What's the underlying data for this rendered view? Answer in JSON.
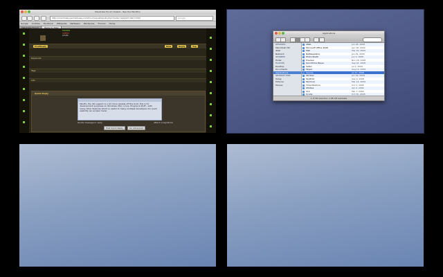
{
  "browser": {
    "title": "Mandrake Forum Hosted - Tear the Mindflux",
    "url": "http://mandrake.seomadness.com/forums/posts/post.php?mode=reply&f=1&t=1344",
    "search_placeholder": "Google",
    "bookmarks": [
      "Google",
      "YouTube",
      "Facebook",
      "Wikipedia",
      "Netbeans",
      "Wordpress",
      "Forums",
      "Home"
    ],
    "tabs": [
      "Mandrake Forum",
      "Reply to Topic"
    ],
    "forum": {
      "stats": [
        "POWER",
        "SPEED",
        "LEVEL"
      ],
      "post_reply_label": "PostReply",
      "right_buttons": [
        "New",
        "Reply",
        "Top"
      ],
      "sections": [
        "Keywords",
        "Tags",
        "Info"
      ],
      "quick_reply_title": "Quick Reply",
      "reply_text": "Mindfx, the XD support is a lot more reliable off the boot, this is for development purposes on Windows, Mac, Linux, Plugins & Stuff - with many other features which is useful to many multiple developers for quick usability (an answer here).",
      "checkboxes": [
        "Quote message in reply",
        "Attach a signature"
      ],
      "buttons": [
        "Post Quick Reply",
        "Go Advanced"
      ]
    }
  },
  "finder": {
    "title": "Applications",
    "sidebar": [
      {
        "label": "DEVICES",
        "header": true
      },
      {
        "label": "Macintosh HD"
      },
      {
        "label": "iDisk"
      },
      {
        "label": "Network"
      },
      {
        "label": "SHARED",
        "header": true
      },
      {
        "label": "finder"
      },
      {
        "label": "PLACES",
        "header": true
      },
      {
        "label": "Desktop"
      },
      {
        "label": "Documents"
      },
      {
        "label": "Applications",
        "selected": true
      },
      {
        "label": "SEARCH FOR",
        "header": true
      },
      {
        "label": "Today"
      },
      {
        "label": "Pictures"
      },
      {
        "label": "Movies"
      }
    ],
    "items": [
      {
        "name": "iWeb",
        "date": "Jun 18, 2008"
      },
      {
        "name": "Microsoft Office 2008",
        "date": "Apr 18, 2009"
      },
      {
        "name": "Mail",
        "date": "Mar 10, 2009"
      },
      {
        "name": "NetNewsWire",
        "date": "Jan 29, 2009"
      },
      {
        "name": "Photo Booth",
        "date": "Jun 5, 2008"
      },
      {
        "name": "Preview",
        "date": "Nov 26, 2008"
      },
      {
        "name": "QuickTime Player",
        "date": "Sep 24, 2008"
      },
      {
        "name": "Safari",
        "date": "Jul 2, 2009"
      },
      {
        "name": "Skype",
        "date": "Aug 12, 2009"
      },
      {
        "name": "Spaces",
        "date": "Jul 27, 2008",
        "selected": true
      },
      {
        "name": "Stickies",
        "date": "Jan 16, 2008"
      },
      {
        "name": "TextEdit",
        "date": "Sep 9, 2008"
      },
      {
        "name": "Terminal",
        "date": "Mar 14, 2009"
      },
      {
        "name": "Time Machine",
        "date": "Oct 3, 2008"
      },
      {
        "name": "Utilities",
        "date": "Apr 2, 2009"
      },
      {
        "name": "VLC",
        "date": "Feb 7, 2009"
      },
      {
        "name": "Xcode",
        "date": "Oct 30, 2008"
      }
    ],
    "status": "1 of 48 selected, 2.08 GB available"
  }
}
